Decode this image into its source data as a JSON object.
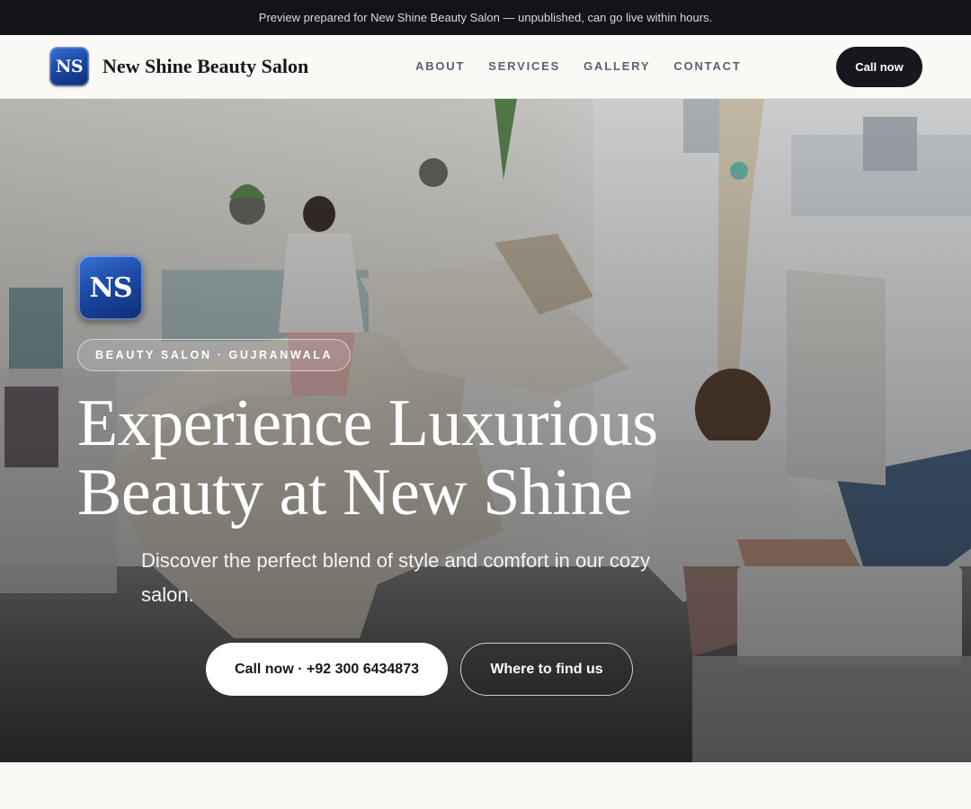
{
  "banner": {
    "text": "Preview prepared for New Shine Beauty Salon — unpublished, can go live within hours."
  },
  "header": {
    "logo_initials": "NS",
    "brand_name": "New Shine Beauty Salon",
    "nav": [
      {
        "label": "ABOUT"
      },
      {
        "label": "SERVICES"
      },
      {
        "label": "GALLERY"
      },
      {
        "label": "CONTACT"
      }
    ],
    "cta_label": "Call now"
  },
  "hero": {
    "logo_initials": "NS",
    "tag": "BEAUTY SALON · GUJRANWALA",
    "title_line1": "Experience Luxurious",
    "title_line2": "Beauty at New Shine",
    "subtitle": "Discover the perfect blend of style and comfort in our cozy salon.",
    "primary_cta": "Call now · +92 300 6434873",
    "secondary_cta": "Where to find us"
  },
  "colors": {
    "banner_bg": "#121419",
    "accent_dark": "#16181d",
    "logo_blue": "#1c4aa6",
    "page_bg": "#faf9f6"
  }
}
